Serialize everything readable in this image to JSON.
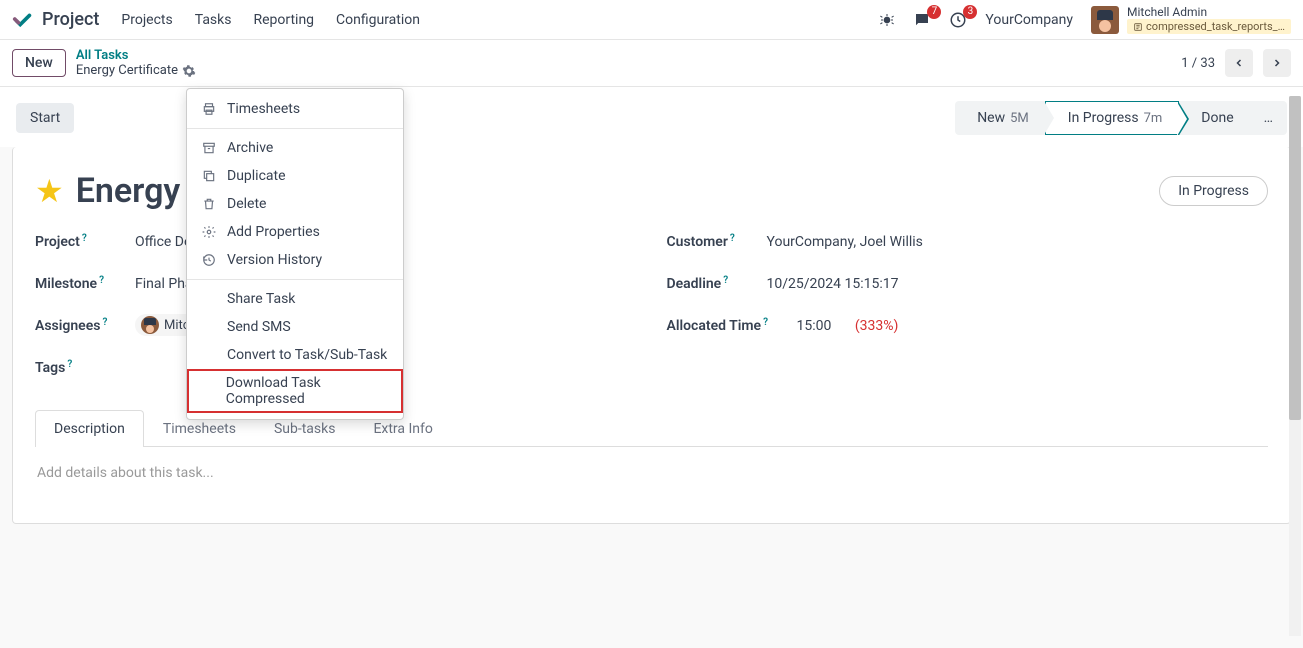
{
  "nav": {
    "brand": "Project",
    "items": [
      "Projects",
      "Tasks",
      "Reporting",
      "Configuration"
    ],
    "msg_badge": "7",
    "activity_badge": "3",
    "company": "YourCompany",
    "user_name": "Mitchell Admin",
    "file_chip": "compressed_task_reports_…"
  },
  "crumb": {
    "new_btn": "New",
    "top": "All Tasks",
    "bot": "Energy Certificate",
    "pager": "1 / 33"
  },
  "action": {
    "start": "Start",
    "stages": {
      "new": "New",
      "new_time": "5M",
      "prog": "In Progress",
      "prog_time": "7m",
      "done": "Done",
      "more": "…"
    }
  },
  "task": {
    "title": "Energy",
    "status_chip": "In Progress",
    "labels": {
      "project": "Project",
      "milestone": "Milestone",
      "assignees": "Assignees",
      "tags": "Tags",
      "customer": "Customer",
      "deadline": "Deadline",
      "allocated": "Allocated Time"
    },
    "values": {
      "project": "Office De",
      "milestone": "Final Pha",
      "assignee": "Mitch",
      "customer": "YourCompany, Joel Willis",
      "deadline": "10/25/2024 15:15:17",
      "allocated_hours": "15:00",
      "allocated_pct": "(333%)"
    }
  },
  "tabs": {
    "items": [
      "Description",
      "Timesheets",
      "Sub-tasks",
      "Extra Info"
    ],
    "placeholder": "Add details about this task..."
  },
  "menu": {
    "timesheets": "Timesheets",
    "archive": "Archive",
    "duplicate": "Duplicate",
    "delete": "Delete",
    "properties": "Add Properties",
    "history": "Version History",
    "share": "Share Task",
    "sms": "Send SMS",
    "convert": "Convert to Task/Sub-Task",
    "download": "Download Task Compressed"
  }
}
